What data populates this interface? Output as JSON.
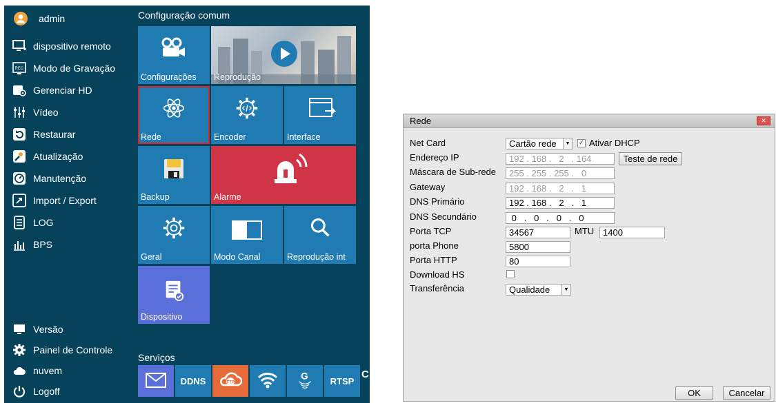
{
  "menu": {
    "user": {
      "name": "admin",
      "icon": "user-avatar-icon"
    },
    "side_items": [
      {
        "label": "dispositivo remoto",
        "icon": "monitor-plus-icon"
      },
      {
        "label": "Modo de Gravação",
        "icon": "rec-icon"
      },
      {
        "label": "Gerenciar HD",
        "icon": "hdd-settings-icon"
      },
      {
        "label": "Vídeo",
        "icon": "sliders-icon"
      },
      {
        "label": "Restaurar",
        "icon": "restore-icon"
      },
      {
        "label": "Atualização",
        "icon": "upgrade-icon"
      },
      {
        "label": "Manutenção",
        "icon": "maintenance-icon"
      },
      {
        "label": "Import / Export",
        "icon": "import-export-icon"
      },
      {
        "label": "LOG",
        "icon": "log-icon"
      },
      {
        "label": "BPS",
        "icon": "bps-icon"
      }
    ],
    "bottom_items": [
      {
        "label": "Versão",
        "icon": "version-icon"
      },
      {
        "label": "Painel de Controle",
        "icon": "gear-icon"
      },
      {
        "label": "nuvem",
        "icon": "cloud-icon"
      },
      {
        "label": "Logoff",
        "icon": "power-icon"
      }
    ],
    "common_title": "Configuração comum",
    "tiles": {
      "configuracoes": "Configurações",
      "reproducao": "Reprodução",
      "rede": "Rede",
      "encoder": "Encoder",
      "interface": "Interface",
      "backup": "Backup",
      "alarme": "Alarme",
      "geral": "Geral",
      "modo_canal": "Modo Canal",
      "reproducao_int": "Reprodução int",
      "dispositivo": "Dispositivo"
    },
    "services_title": "Serviços",
    "services": [
      "DDNS",
      "RTSP"
    ],
    "services_overflow": "C",
    "colors": {
      "panel": "#06425a",
      "tile": "#1f7bb1",
      "alarm": "#cf3546",
      "device": "#5a6fd9",
      "selected_outline": "#d9252a"
    }
  },
  "dialog": {
    "title": "Rede",
    "net_card": {
      "label": "Net Card",
      "value": "Cartão rede",
      "dhcp_label": "Ativar DHCP",
      "dhcp_checked": true
    },
    "ip": {
      "label": "Endereço IP",
      "octets": [
        "192",
        "168",
        "2",
        "164"
      ],
      "test_button": "Teste de rede"
    },
    "mask": {
      "label": "Máscara de Sub-rede",
      "octets": [
        "255",
        "255",
        "255",
        "0"
      ]
    },
    "gateway": {
      "label": "Gateway",
      "octets": [
        "192",
        "168",
        "2",
        "1"
      ]
    },
    "dns1": {
      "label": "DNS Primário",
      "octets": [
        "192",
        "168",
        "2",
        "1"
      ]
    },
    "dns2": {
      "label": "DNS Secundário",
      "octets": [
        "0",
        "0",
        "0",
        "0"
      ]
    },
    "tcp": {
      "label": "Porta TCP",
      "value": "34567",
      "mtu_label": "MTU",
      "mtu_value": "1400"
    },
    "phone": {
      "label": "porta Phone",
      "value": "5800"
    },
    "http": {
      "label": "Porta HTTP",
      "value": "80"
    },
    "download_hs": {
      "label": "Download HS",
      "checked": false
    },
    "transfer": {
      "label": "Transferência",
      "value": "Qualidade"
    },
    "ok_button": "OK",
    "cancel_button": "Cancelar"
  }
}
